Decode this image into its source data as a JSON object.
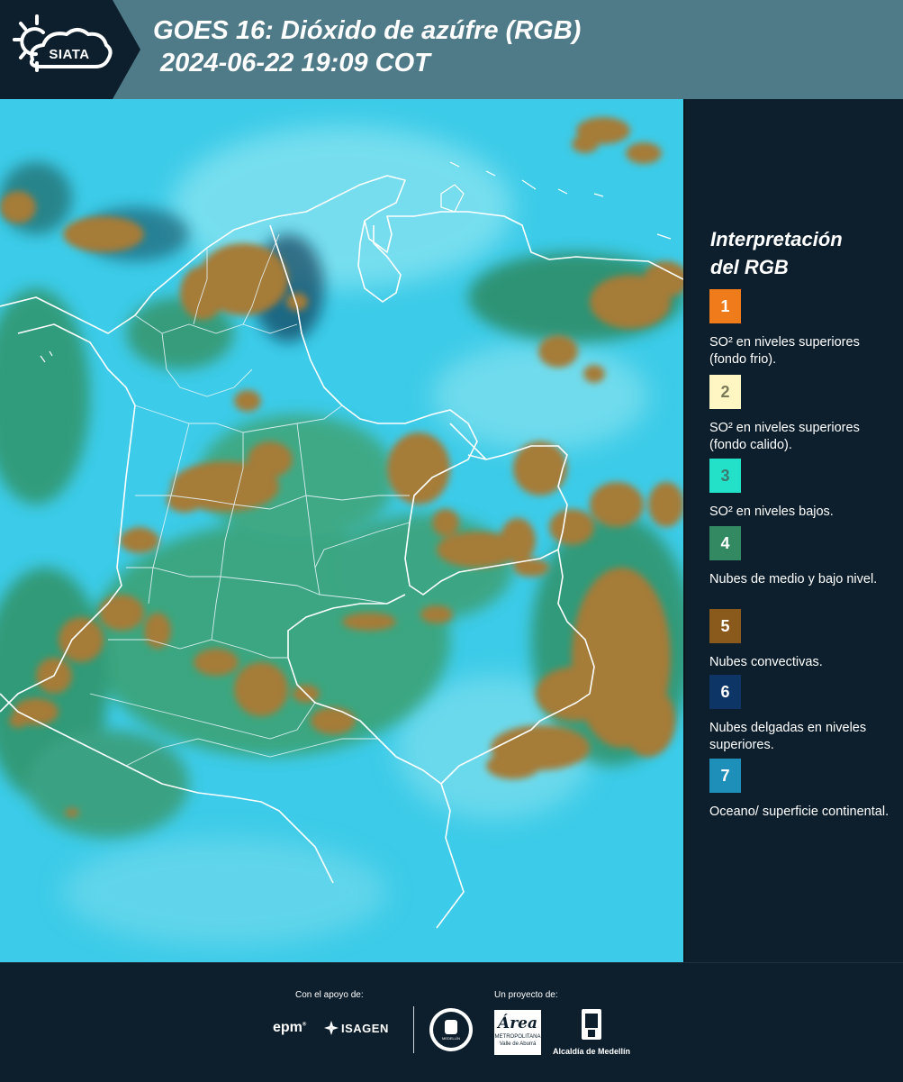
{
  "header": {
    "logo_text": "SIATA",
    "title_line1": "GOES 16: Dióxido de azúfre (RGB)",
    "title_line2": "2024-06-22 19:09 COT",
    "colors": {
      "header_bg": "#4f7a87",
      "logo_bg": "#0d1f2d"
    }
  },
  "map": {
    "description_colors": {
      "surface": "#38c8e6",
      "convective": "#a57b38",
      "low_level": "#2e8a4a",
      "thin_high": "#0e3550",
      "borders": "#ffffff"
    }
  },
  "legend": {
    "title_line1": "Interpretación",
    "title_line2": "del RGB",
    "items": [
      {
        "num": "1",
        "color": "#f07b1a",
        "num_color": "#ffffff",
        "text": "SO² en niveles superiores (fondo frio)."
      },
      {
        "num": "2",
        "color": "#fff6c4",
        "num_color": "#7a7a5a",
        "text": "SO² en niveles superiores (fondo calido)."
      },
      {
        "num": "3",
        "color": "#23e1c8",
        "num_color": "#3a7a70",
        "text": "SO² en niveles bajos."
      },
      {
        "num": "4",
        "color": "#338a62",
        "num_color": "#ffffff",
        "text": "Nubes de medio y bajo nivel."
      },
      {
        "num": "5",
        "color": "#8a5a1c",
        "num_color": "#ffffff",
        "text": "Nubes convectivas."
      },
      {
        "num": "6",
        "color": "#0d3566",
        "num_color": "#ffffff",
        "text": "Nubes delgadas en niveles superiores."
      },
      {
        "num": "7",
        "color": "#1e8fb8",
        "num_color": "#ffffff",
        "text": "Oceano/ superficie continental."
      }
    ]
  },
  "footer": {
    "support_label": "Con el apoyo de:",
    "project_label": "Un proyecto de:",
    "sponsors": [
      "epm",
      "ISAGEN"
    ],
    "partners": [
      "MEDELLÍN",
      "Área",
      "METROPOLITANA",
      "Valle de Aburrá",
      "Alcaldía de Medellín"
    ]
  }
}
